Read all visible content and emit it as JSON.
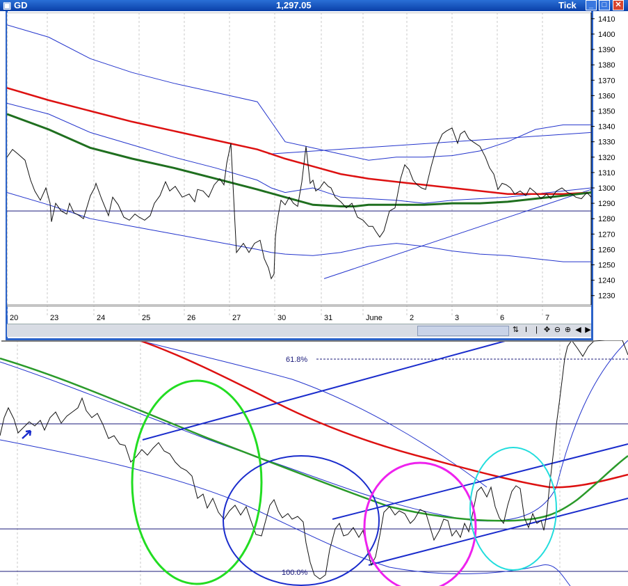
{
  "window": {
    "title": "GD",
    "last_price": "1,297.05",
    "mode": "Tick",
    "buttons": [
      "minimize-icon",
      "maximize-icon",
      "close-icon"
    ]
  },
  "chart_data": [
    {
      "type": "line",
      "title": "GD",
      "x_labels": [
        "20",
        "23",
        "24",
        "25",
        "26",
        "27",
        "30",
        "31",
        "June",
        "2",
        "3",
        "6",
        "7"
      ],
      "yticks": [
        1230,
        1240,
        1250,
        1260,
        1270,
        1280,
        1290,
        1300,
        1310,
        1320,
        1330,
        1340,
        1350,
        1360,
        1370,
        1380,
        1390,
        1400,
        1410
      ],
      "ylim": [
        1224,
        1414
      ],
      "horizontal_line": 1285,
      "price_series": {
        "name": "",
        "x": [
          0,
          8,
          16,
          26,
          34,
          40,
          48,
          56,
          62,
          64,
          70,
          78,
          86,
          90,
          96,
          104,
          110,
          120,
          126,
          128,
          136,
          146,
          152,
          160,
          168,
          176,
          184,
          190,
          198,
          206,
          212,
          220,
          228,
          234,
          242,
          252,
          262,
          270,
          274,
          282,
          290,
          298,
          306,
          312,
          316,
          322,
          330,
          340,
          348,
          356,
          364,
          370,
          376,
          380,
          384,
          386,
          388,
          390,
          394,
          400,
          406,
          412,
          418,
          424,
          430,
          436,
          440,
          444,
          450,
          456,
          462,
          466,
          472,
          480,
          488,
          496,
          504,
          512,
          520,
          526,
          530,
          536,
          542,
          550,
          558,
          566,
          572,
          578,
          584,
          590,
          596,
          602,
          610,
          618,
          626,
          632,
          640,
          648,
          652,
          658,
          664,
          670,
          680,
          688,
          694,
          700,
          706,
          712,
          718,
          724,
          730,
          738,
          746,
          752,
          760,
          768,
          776,
          782,
          790,
          798,
          806,
          812,
          818,
          826,
          834,
          840
        ],
        "y": [
          1320,
          1325,
          1322,
          1318,
          1305,
          1298,
          1292,
          1300,
          1290,
          1278,
          1290,
          1285,
          1283,
          1290,
          1284,
          1282,
          1280,
          1295,
          1300,
          1303,
          1293,
          1282,
          1294,
          1289,
          1281,
          1279,
          1283,
          1281,
          1279,
          1282,
          1290,
          1295,
          1304,
          1298,
          1301,
          1294,
          1296,
          1291,
          1299,
          1298,
          1294,
          1302,
          1306,
          1302,
          1316,
          1329,
          1258,
          1264,
          1258,
          1264,
          1266,
          1254,
          1248,
          1241,
          1244,
          1268,
          1276,
          1282,
          1292,
          1289,
          1294,
          1290,
          1288,
          1304,
          1327,
          1303,
          1305,
          1298,
          1300,
          1304,
          1301,
          1300,
          1294,
          1291,
          1287,
          1290,
          1281,
          1279,
          1275,
          1275,
          1272,
          1268,
          1272,
          1285,
          1287,
          1306,
          1315,
          1312,
          1305,
          1302,
          1300,
          1299,
          1314,
          1327,
          1335,
          1337,
          1339,
          1329,
          1335,
          1337,
          1332,
          1330,
          1327,
          1320,
          1313,
          1309,
          1299,
          1303,
          1302,
          1300,
          1296,
          1298,
          1295,
          1300,
          1297,
          1293,
          1296,
          1293,
          1298,
          1300,
          1297,
          1296,
          1294,
          1293,
          1297,
          1294
        ]
      },
      "upper_band": {
        "x": [
          0,
          60,
          120,
          180,
          240,
          300,
          360,
          380,
          400,
          440,
          480,
          520,
          560,
          600,
          640,
          680,
          720,
          760,
          800,
          840
        ],
        "y": [
          1406,
          1398,
          1384,
          1375,
          1368,
          1362,
          1356,
          1343,
          1330,
          1326,
          1322,
          1318,
          1320,
          1320,
          1321,
          1324,
          1330,
          1338,
          1341,
          1341
        ]
      },
      "lower_band": {
        "x": [
          0,
          60,
          120,
          180,
          240,
          300,
          360,
          380,
          400,
          440,
          480,
          520,
          560,
          600,
          640,
          680,
          720,
          760,
          800,
          840
        ],
        "y": [
          1297,
          1289,
          1280,
          1275,
          1270,
          1265,
          1260,
          1258,
          1257,
          1256,
          1258,
          1262,
          1264,
          1262,
          1259,
          1257,
          1256,
          1254,
          1252,
          1252
        ]
      },
      "inner_band": {
        "x": [
          0,
          60,
          120,
          180,
          240,
          300,
          360,
          380,
          400,
          440,
          480,
          520,
          560,
          600,
          640,
          680,
          720,
          760,
          800,
          840
        ],
        "y": [
          1355,
          1348,
          1336,
          1328,
          1320,
          1313,
          1305,
          1300,
          1297,
          1300,
          1294,
          1293,
          1292,
          1290,
          1292,
          1293,
          1294,
          1296,
          1298,
          1300
        ]
      },
      "red_ma": {
        "x": [
          0,
          60,
          120,
          180,
          240,
          300,
          360,
          400,
          440,
          480,
          520,
          560,
          600,
          640,
          680,
          720,
          760,
          800,
          840
        ],
        "y": [
          1365,
          1357,
          1350,
          1343,
          1337,
          1331,
          1325,
          1319,
          1314,
          1309,
          1306,
          1304,
          1302,
          1300,
          1298,
          1296,
          1296,
          1296,
          1297
        ]
      },
      "green_ma": {
        "x": [
          0,
          60,
          120,
          180,
          240,
          300,
          360,
          400,
          440,
          480,
          500,
          520,
          560,
          600,
          640,
          680,
          720,
          760,
          800,
          840
        ],
        "y": [
          1348,
          1338,
          1326,
          1319,
          1313,
          1306,
          1299,
          1294,
          1289,
          1288,
          1288,
          1289,
          1289,
          1289,
          1290,
          1290,
          1291,
          1293,
          1295,
          1297
        ]
      },
      "trendline": {
        "x": [
          456,
          840
        ],
        "y": [
          1241,
          1299
        ]
      },
      "upper_trendline": {
        "x": [
          376,
          840
        ],
        "y": [
          1322,
          1336
        ]
      }
    },
    {
      "type": "line",
      "title": "",
      "annotations": [
        "61.8%",
        "100.0%"
      ]
    }
  ]
}
